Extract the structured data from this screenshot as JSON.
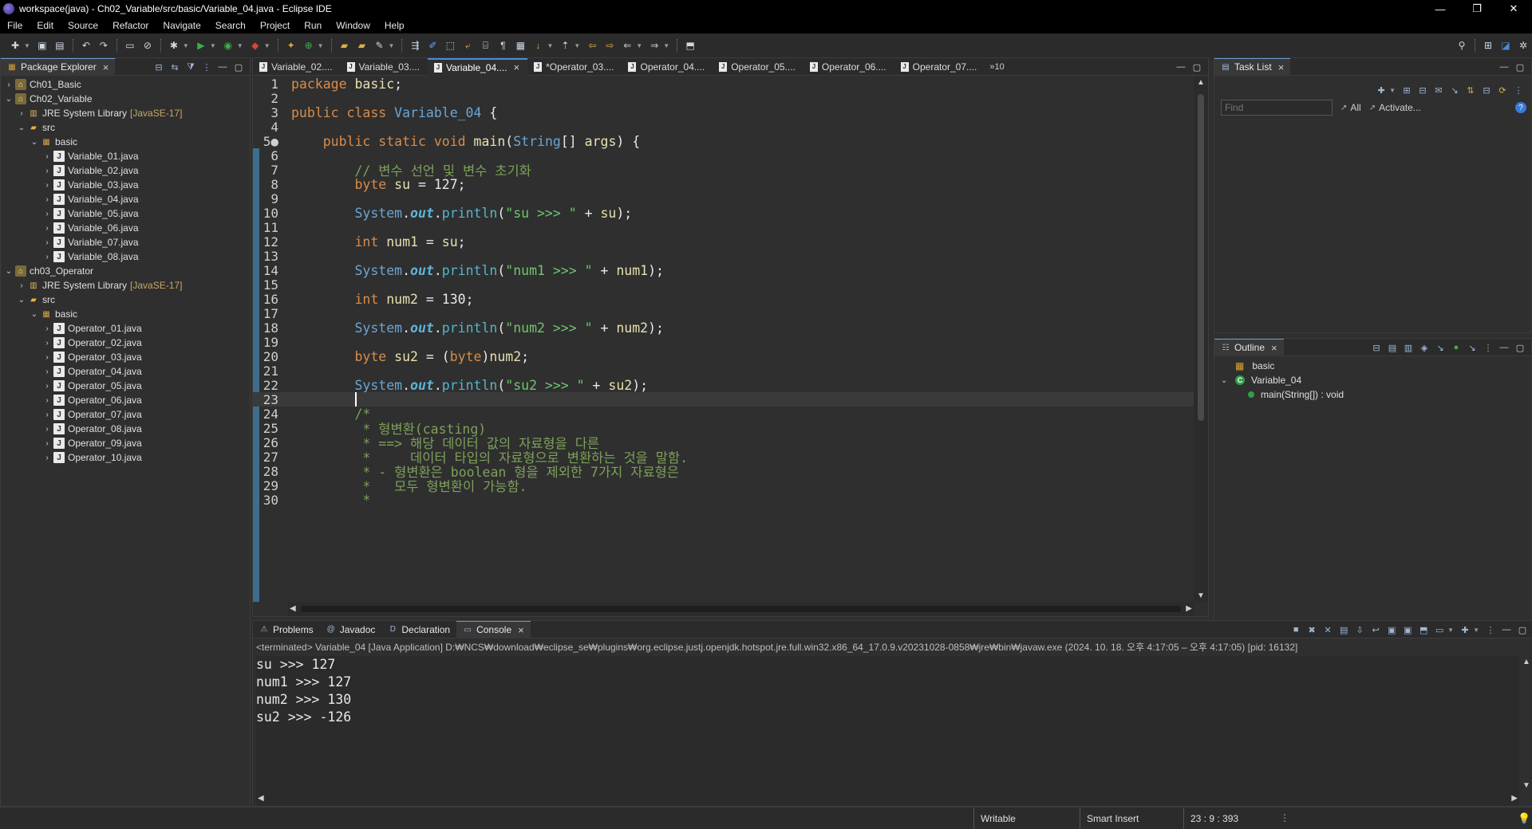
{
  "window": {
    "title": "workspace(java) - Ch02_Variable/src/basic/Variable_04.java - Eclipse IDE",
    "controls": [
      "—",
      "❐",
      "✕"
    ]
  },
  "menu": [
    "File",
    "Edit",
    "Source",
    "Refactor",
    "Navigate",
    "Search",
    "Project",
    "Run",
    "Window",
    "Help"
  ],
  "package_explorer": {
    "title": "Package Explorer",
    "tree": [
      {
        "label": "Ch01_Basic",
        "level": 0,
        "twisty": "›",
        "icon": "project-icon"
      },
      {
        "label": "Ch02_Variable",
        "level": 0,
        "twisty": "⌄",
        "icon": "project-icon"
      },
      {
        "label": "JRE System Library",
        "deco": "[JavaSE-17]",
        "level": 1,
        "twisty": "›",
        "icon": "library-icon"
      },
      {
        "label": "src",
        "level": 1,
        "twisty": "⌄",
        "icon": "source-folder-icon"
      },
      {
        "label": "basic",
        "level": 2,
        "twisty": "⌄",
        "icon": "package-icon"
      },
      {
        "label": "Variable_01.java",
        "level": 3,
        "twisty": "›",
        "icon": "java-file-icon"
      },
      {
        "label": "Variable_02.java",
        "level": 3,
        "twisty": "›",
        "icon": "java-file-icon"
      },
      {
        "label": "Variable_03.java",
        "level": 3,
        "twisty": "›",
        "icon": "java-file-icon"
      },
      {
        "label": "Variable_04.java",
        "level": 3,
        "twisty": "›",
        "icon": "java-file-icon"
      },
      {
        "label": "Variable_05.java",
        "level": 3,
        "twisty": "›",
        "icon": "java-file-icon"
      },
      {
        "label": "Variable_06.java",
        "level": 3,
        "twisty": "›",
        "icon": "java-file-icon"
      },
      {
        "label": "Variable_07.java",
        "level": 3,
        "twisty": "›",
        "icon": "java-file-icon"
      },
      {
        "label": "Variable_08.java",
        "level": 3,
        "twisty": "›",
        "icon": "java-file-icon"
      },
      {
        "label": "ch03_Operator",
        "level": 0,
        "twisty": "⌄",
        "icon": "project-icon"
      },
      {
        "label": "JRE System Library",
        "deco": "[JavaSE-17]",
        "level": 1,
        "twisty": "›",
        "icon": "library-icon"
      },
      {
        "label": "src",
        "level": 1,
        "twisty": "⌄",
        "icon": "source-folder-icon"
      },
      {
        "label": "basic",
        "level": 2,
        "twisty": "⌄",
        "icon": "package-icon"
      },
      {
        "label": "Operator_01.java",
        "level": 3,
        "twisty": "›",
        "icon": "java-file-icon"
      },
      {
        "label": "Operator_02.java",
        "level": 3,
        "twisty": "›",
        "icon": "java-file-icon"
      },
      {
        "label": "Operator_03.java",
        "level": 3,
        "twisty": "›",
        "icon": "java-file-icon"
      },
      {
        "label": "Operator_04.java",
        "level": 3,
        "twisty": "›",
        "icon": "java-file-icon"
      },
      {
        "label": "Operator_05.java",
        "level": 3,
        "twisty": "›",
        "icon": "java-file-icon"
      },
      {
        "label": "Operator_06.java",
        "level": 3,
        "twisty": "›",
        "icon": "java-file-icon"
      },
      {
        "label": "Operator_07.java",
        "level": 3,
        "twisty": "›",
        "icon": "java-file-icon"
      },
      {
        "label": "Operator_08.java",
        "level": 3,
        "twisty": "›",
        "icon": "java-file-icon"
      },
      {
        "label": "Operator_09.java",
        "level": 3,
        "twisty": "›",
        "icon": "java-file-icon"
      },
      {
        "label": "Operator_10.java",
        "level": 3,
        "twisty": "›",
        "icon": "java-file-icon"
      }
    ]
  },
  "editor": {
    "tabs": [
      {
        "label": "Variable_02....",
        "active": false
      },
      {
        "label": "Variable_03....",
        "active": false
      },
      {
        "label": "Variable_04....",
        "active": true
      },
      {
        "label": "*Operator_03....",
        "active": false
      },
      {
        "label": "Operator_04....",
        "active": false
      },
      {
        "label": "Operator_05....",
        "active": false
      },
      {
        "label": "Operator_06....",
        "active": false
      },
      {
        "label": "Operator_07....",
        "active": false
      }
    ],
    "overflow_label": "»10",
    "current_line": 23,
    "lines": [
      {
        "n": "1",
        "t": "package basic;"
      },
      {
        "n": "2",
        "t": ""
      },
      {
        "n": "3",
        "t": "public class Variable_04 {"
      },
      {
        "n": "4",
        "t": ""
      },
      {
        "n": "5●",
        "t": "    public static void main(String[] args) {"
      },
      {
        "n": "6",
        "t": ""
      },
      {
        "n": "7",
        "t": "        // 변수 선언 및 변수 초기화"
      },
      {
        "n": "8",
        "t": "        byte su = 127;"
      },
      {
        "n": "9",
        "t": ""
      },
      {
        "n": "10",
        "t": "        System.out.println(\"su >>> \" + su);"
      },
      {
        "n": "11",
        "t": ""
      },
      {
        "n": "12",
        "t": "        int num1 = su;"
      },
      {
        "n": "13",
        "t": ""
      },
      {
        "n": "14",
        "t": "        System.out.println(\"num1 >>> \" + num1);"
      },
      {
        "n": "15",
        "t": ""
      },
      {
        "n": "16",
        "t": "        int num2 = 130;"
      },
      {
        "n": "17",
        "t": ""
      },
      {
        "n": "18",
        "t": "        System.out.println(\"num2 >>> \" + num2);"
      },
      {
        "n": "19",
        "t": ""
      },
      {
        "n": "20",
        "t": "        byte su2 = (byte)num2;"
      },
      {
        "n": "21",
        "t": ""
      },
      {
        "n": "22",
        "t": "        System.out.println(\"su2 >>> \" + su2);"
      },
      {
        "n": "23",
        "t": ""
      },
      {
        "n": "24",
        "t": "        /*"
      },
      {
        "n": "25",
        "t": "         * 형변환(casting)"
      },
      {
        "n": "26",
        "t": "         * ==> 해당 데이터 값의 자료형을 다른"
      },
      {
        "n": "27",
        "t": "         *     데이터 타입의 자료형으로 변환하는 것을 말함."
      },
      {
        "n": "28",
        "t": "         * - 형변환은 boolean 형을 제외한 7가지 자료형은"
      },
      {
        "n": "29",
        "t": "         *   모두 형변환이 가능함."
      },
      {
        "n": "30",
        "t": "         *"
      }
    ]
  },
  "task_list": {
    "title": "Task List",
    "find_placeholder": "Find",
    "all_label": "All",
    "activate_label": "Activate..."
  },
  "outline": {
    "title": "Outline",
    "items": [
      {
        "label": "basic",
        "kind": "package"
      },
      {
        "label": "Variable_04",
        "kind": "class"
      },
      {
        "label": "main(String[]) : void",
        "kind": "method"
      }
    ]
  },
  "console": {
    "tabs": [
      {
        "label": "Problems",
        "active": false,
        "icon": "problems-icon"
      },
      {
        "label": "Javadoc",
        "active": false,
        "icon": "javadoc-icon"
      },
      {
        "label": "Declaration",
        "active": false,
        "icon": "declaration-icon"
      },
      {
        "label": "Console",
        "active": true,
        "icon": "console-icon"
      }
    ],
    "process_line": "<terminated> Variable_04 [Java Application] D:₩NCS₩download₩eclipse_se₩plugins₩org.eclipse.justj.openjdk.hotspot.jre.full.win32.x86_64_17.0.9.v20231028-0858₩jre₩bin₩javaw.exe  (2024. 10. 18. 오후 4:17:05 – 오후 4:17:05) [pid: 16132]",
    "output": [
      "su >>> 127",
      "num1 >>> 127",
      "num2 >>> 130",
      "su2 >>> -126"
    ]
  },
  "status": {
    "writable": "Writable",
    "insert_mode": "Smart Insert",
    "position": "23 : 9 : 393"
  }
}
